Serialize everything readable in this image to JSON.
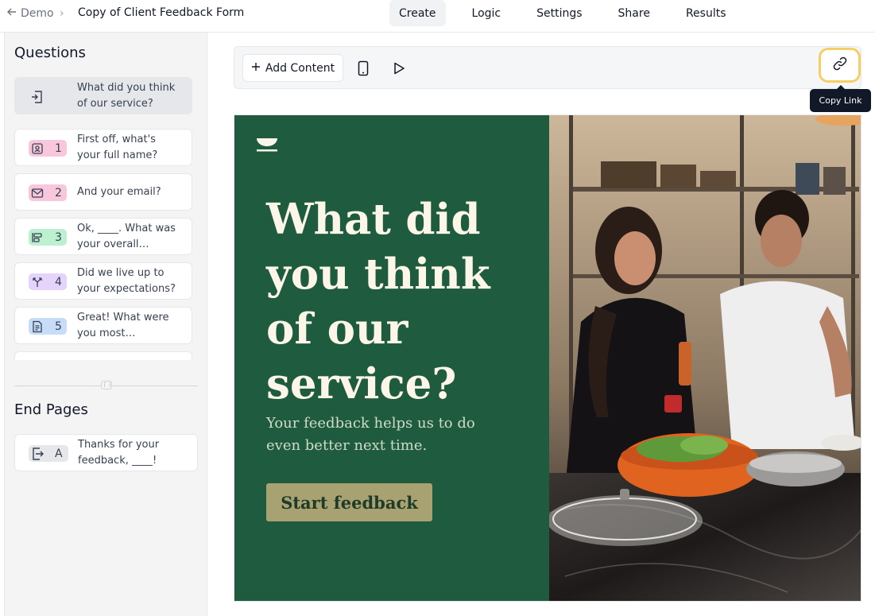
{
  "breadcrumb": {
    "back_label": "Demo",
    "separator": "›",
    "form_title": "Copy of Client Feedback Form"
  },
  "tabs": [
    {
      "label": "Create",
      "active": true
    },
    {
      "label": "Logic"
    },
    {
      "label": "Settings"
    },
    {
      "label": "Share"
    },
    {
      "label": "Results"
    }
  ],
  "sidebar": {
    "questions_title": "Questions",
    "welcome": {
      "icon": "enter-icon",
      "text": "What did you think\nof our service?"
    },
    "questions": [
      {
        "num": "1",
        "icon": "contact-card-icon",
        "color": "#f9c7dc",
        "text": "First off, what's\nyour full name?"
      },
      {
        "num": "2",
        "icon": "mail-icon",
        "color": "#f9c7dc",
        "text": "And your email?"
      },
      {
        "num": "3",
        "icon": "opinion-scale-icon",
        "color": "#bdf0cf",
        "text": "Ok, ____. What was\nyour overall…"
      },
      {
        "num": "4",
        "icon": "branch-icon",
        "color": "#e4d4fb",
        "text": "Did we live up to\nyour expectations?"
      },
      {
        "num": "5",
        "icon": "long-text-icon",
        "color": "#c7dcf9",
        "text": "Great! What were\nyou most…"
      }
    ],
    "end_pages_title": "End Pages",
    "end_pages": [
      {
        "letter": "A",
        "icon": "exit-icon",
        "text": "Thanks for your\nfeedback, ____!"
      }
    ]
  },
  "toolbar": {
    "add_content_label": "Add Content",
    "tooltip": "Copy Link"
  },
  "preview": {
    "headline": "What did\nyou think\nof our\nservice?",
    "subline": "Your feedback helps us to do\neven better next time.",
    "button_label": "Start feedback",
    "panel_color": "#1f5b3e",
    "button_color": "#a8a171"
  }
}
